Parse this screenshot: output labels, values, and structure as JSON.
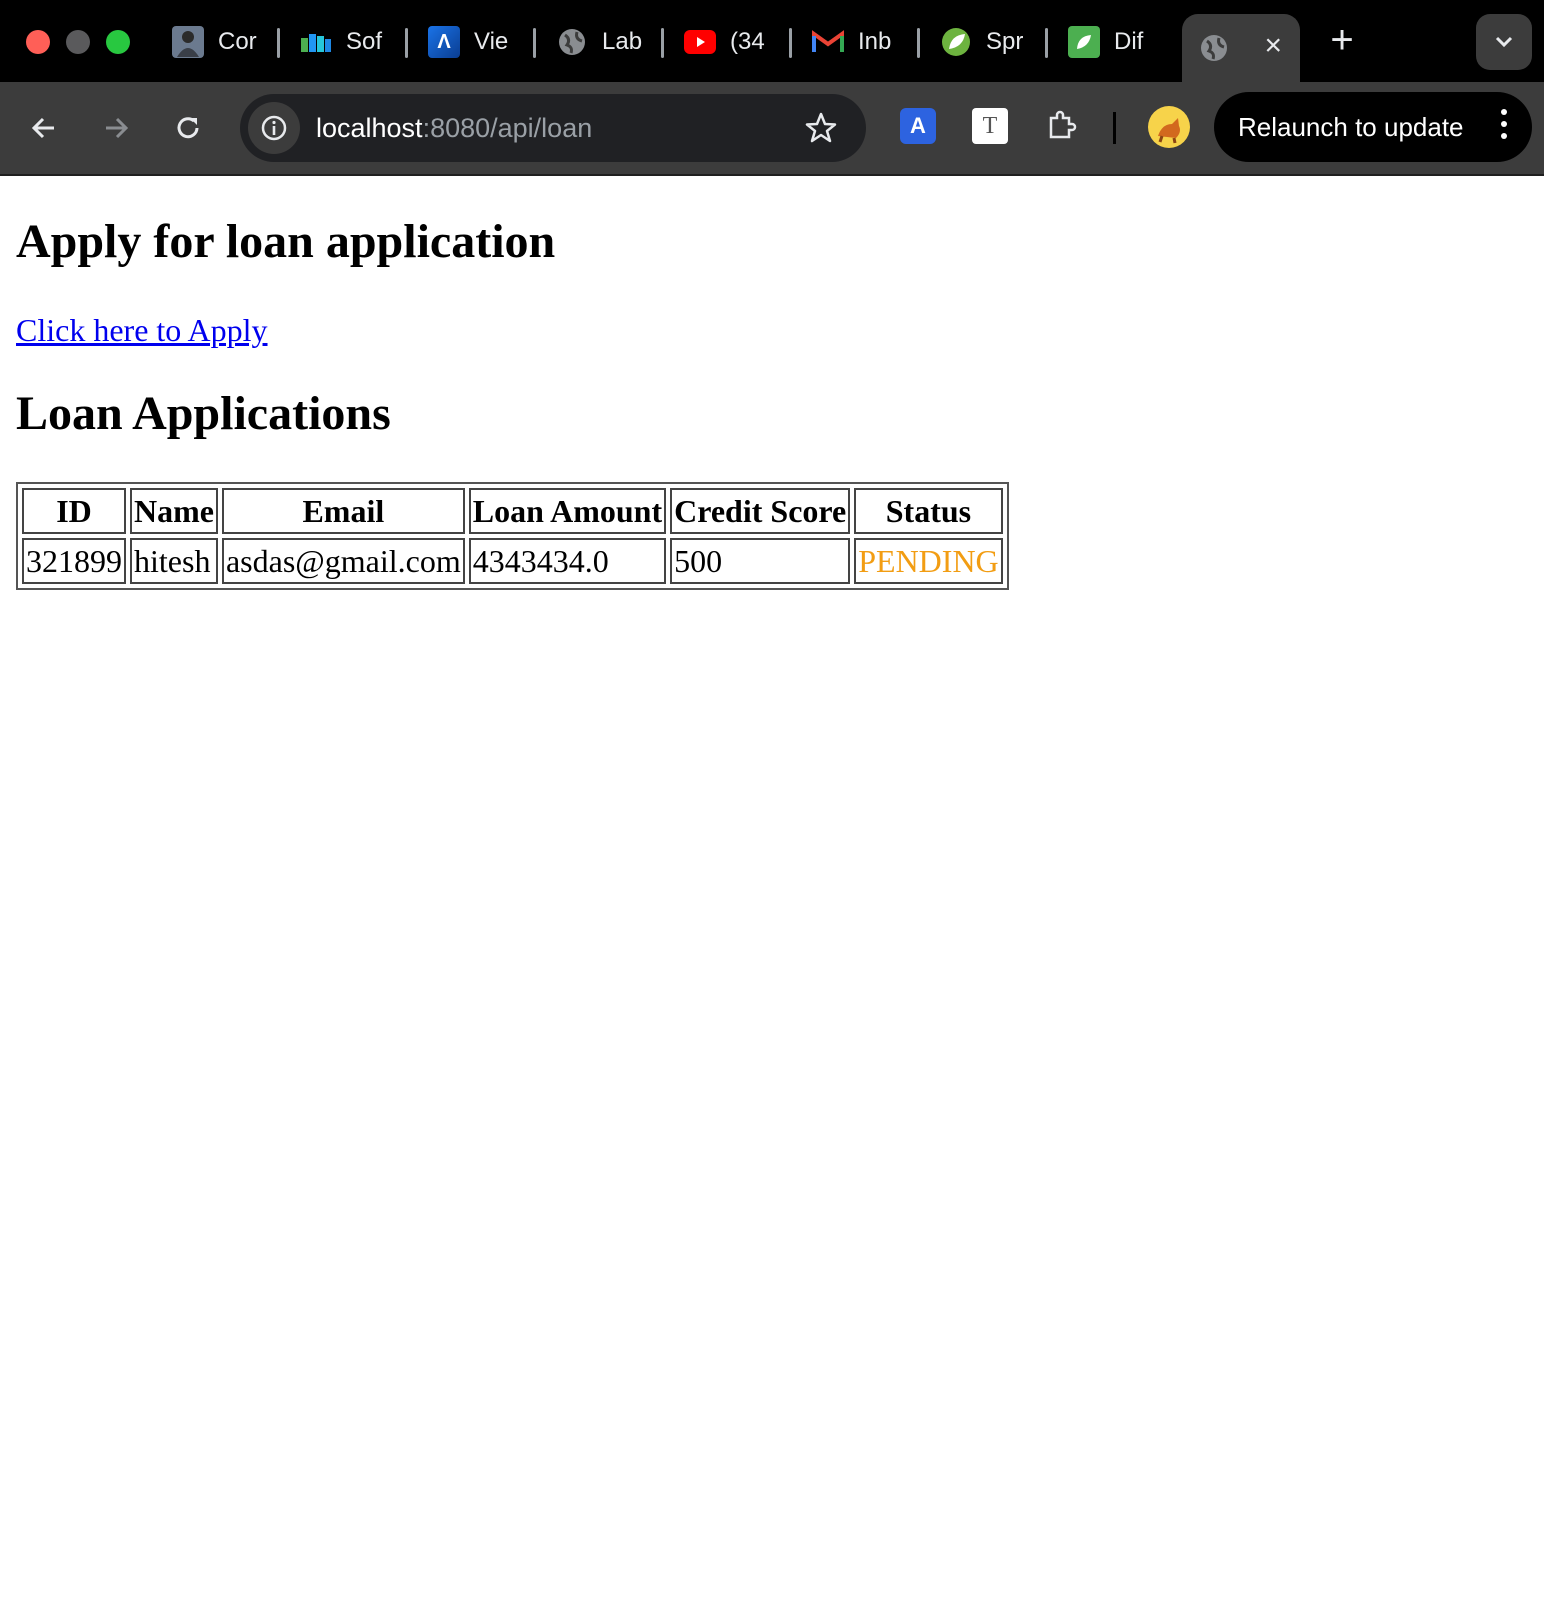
{
  "browser": {
    "tabs": [
      {
        "title": "Cor",
        "icon": "profile-photo-icon"
      },
      {
        "title": "Sof",
        "icon": "books-icon"
      },
      {
        "title": "Vie",
        "icon": "arrow-a-icon"
      },
      {
        "title": "Lab",
        "icon": "globe-icon"
      },
      {
        "title": "(34",
        "icon": "youtube-icon"
      },
      {
        "title": "Inb",
        "icon": "gmail-icon"
      },
      {
        "title": "Spr",
        "icon": "spring-leaf-icon"
      },
      {
        "title": "Dif",
        "icon": "green-leaf-icon"
      }
    ],
    "active_tab": {
      "icon": "globe-icon",
      "close": "×"
    },
    "url_host": "localhost",
    "url_rest": ":8080/api/loan",
    "relaunch_label": "Relaunch to update",
    "colors": {
      "tabstrip": "#000000",
      "toolbar": "#3c3c3c",
      "omnibox": "#202124"
    }
  },
  "page": {
    "heading": "Apply for loan application",
    "apply_link": "Click here to Apply",
    "table_heading": "Loan Applications",
    "table": {
      "columns": [
        "ID",
        "Name",
        "Email",
        "Loan Amount",
        "Credit Score",
        "Status"
      ],
      "rows": [
        {
          "id": "321899",
          "name": "hitesh",
          "email": "asdas@gmail.com",
          "amount": "4343434.0",
          "score": "500",
          "status": "PENDING"
        }
      ]
    },
    "colors": {
      "link": "#0000ee",
      "status_pending": "#f29d13"
    }
  }
}
